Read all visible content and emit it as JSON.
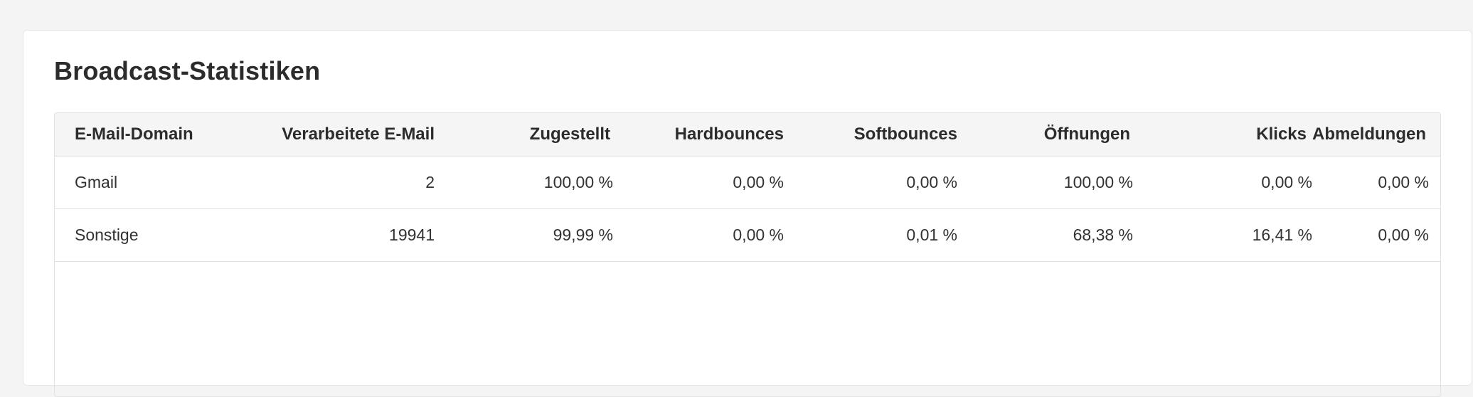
{
  "card": {
    "title": "Broadcast-Statistiken"
  },
  "table": {
    "headers": [
      "E-Mail-Domain",
      "Verarbeitete E-Mail",
      "Zugestellt",
      "Hardbounces",
      "Softbounces",
      "Öffnungen",
      "Klicks",
      "Abmeldungen"
    ],
    "rows": [
      [
        "Gmail",
        "2",
        "100,00 %",
        "0,00 %",
        "0,00 %",
        "100,00 %",
        "0,00 %",
        "0,00 %"
      ],
      [
        "Sonstige",
        "19941",
        "99,99 %",
        "0,00 %",
        "0,01 %",
        "68,38 %",
        "16,41 %",
        "0,00 %"
      ]
    ]
  }
}
